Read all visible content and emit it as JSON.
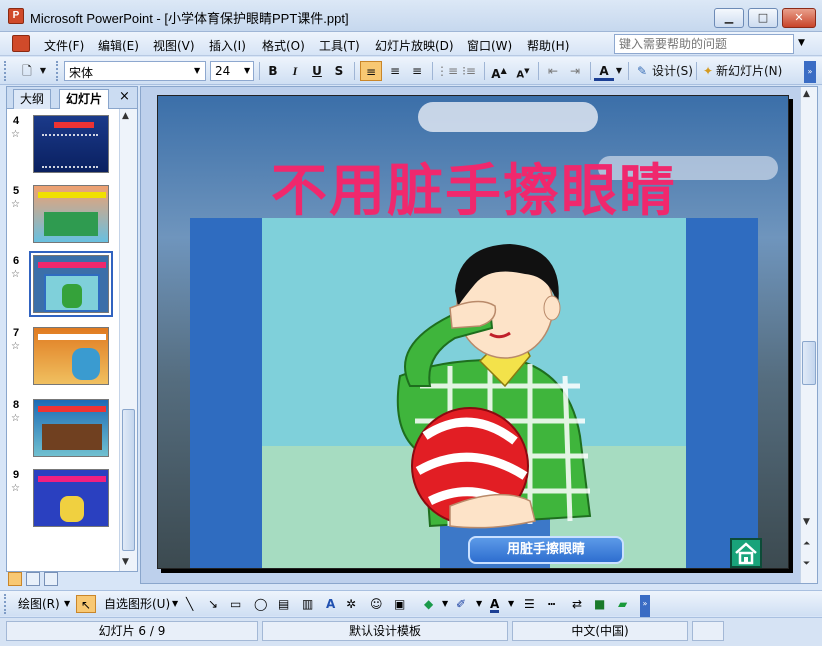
{
  "window": {
    "title": "Microsoft PowerPoint - [小学体育保护眼睛PPT课件.ppt]",
    "app_icon": "powerpoint-icon",
    "controls": [
      "minimize-icon",
      "maximize-icon",
      "close-icon"
    ]
  },
  "menu": {
    "items": [
      "文件(F)",
      "编辑(E)",
      "视图(V)",
      "插入(I)",
      "格式(O)",
      "工具(T)",
      "幻灯片放映(D)",
      "窗口(W)",
      "帮助(H)"
    ],
    "help_placeholder": "键入需要帮助的问题"
  },
  "toolbar": {
    "font": "宋体",
    "size": "24",
    "bold": "B",
    "italic": "I",
    "underline": "U",
    "shadow": "S",
    "design": "设计(S)",
    "new_slide": "新幻灯片(N)"
  },
  "left_pane": {
    "tabs": [
      "大纲",
      "幻灯片"
    ],
    "close": "×",
    "thumbnails": [
      {
        "number": "4"
      },
      {
        "number": "5"
      },
      {
        "number": "6"
      },
      {
        "number": "7"
      },
      {
        "number": "8"
      },
      {
        "number": "9"
      }
    ],
    "selected": "6"
  },
  "slide": {
    "title": "不用脏手擦眼睛",
    "caption_button": "用脏手擦眼睛",
    "home_icon": "home-icon"
  },
  "drawbar": {
    "draw": "绘图(R)",
    "autoshapes": "自选图形(U)"
  },
  "status": {
    "slide": "幻灯片 6 / 9",
    "template": "默认设计模板",
    "language": "中文(中国)"
  },
  "colors": {
    "title_pink": "#f0286d",
    "frame_blue": "#2f6cc0",
    "selected_outline": "#3163c0"
  }
}
